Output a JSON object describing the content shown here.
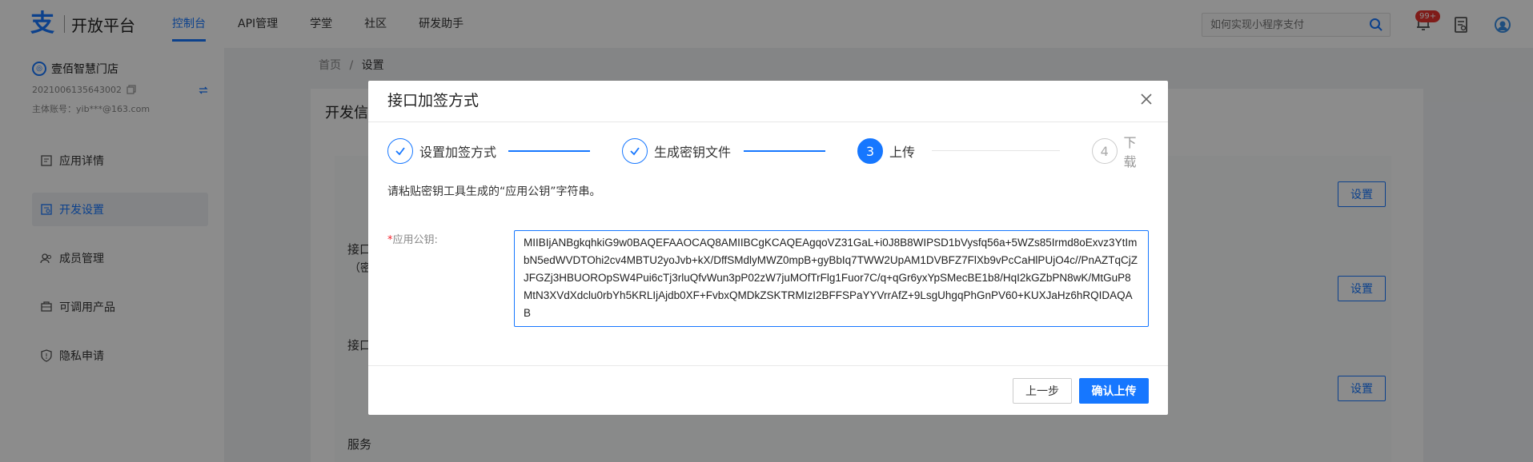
{
  "header": {
    "brand": "开放平台",
    "nav": [
      {
        "label": "控制台",
        "active": true
      },
      {
        "label": "API管理"
      },
      {
        "label": "学堂"
      },
      {
        "label": "社区"
      },
      {
        "label": "研发助手"
      }
    ],
    "search_placeholder": "如何实现小程序支付",
    "notification_badge": "99+"
  },
  "sidebar": {
    "shop_name": "壹佰智慧门店",
    "account_id": "2021006135643002",
    "main_account": "主体账号：yib***@163.com",
    "items": [
      {
        "label": "应用详情",
        "icon": "app-detail-icon"
      },
      {
        "label": "开发设置",
        "icon": "dev-settings-icon",
        "active": true
      },
      {
        "label": "成员管理",
        "icon": "members-icon"
      },
      {
        "label": "可调用产品",
        "icon": "products-icon"
      },
      {
        "label": "隐私申请",
        "icon": "privacy-shield-icon"
      }
    ]
  },
  "breadcrumb": {
    "home": "首页",
    "separator": "/",
    "current": "设置"
  },
  "main": {
    "card_title": "开发信",
    "rows": [
      {
        "label": "接口",
        "sublabel": "（密"
      },
      {
        "label": "接口"
      },
      {
        "label": "服务"
      }
    ],
    "set_label": "设置"
  },
  "modal": {
    "title": "接口加签方式",
    "steps": [
      {
        "label": "设置加签方式",
        "status": "done"
      },
      {
        "label": "生成密钥文件",
        "status": "done"
      },
      {
        "label": "上传",
        "number": "3",
        "status": "active"
      },
      {
        "label": "下载",
        "number": "4",
        "status": "wait"
      }
    ],
    "hint": "请粘贴密钥工具生成的“应用公钥”字符串。",
    "field_required": "*",
    "field_label": "应用公钥:",
    "public_key": "MIIBIjANBgkqhkiG9w0BAQEFAAOCAQ8AMIIBCgKCAQEAgqoVZ31GaL+i0J8B8WIPSD1bVysfq56a+5WZs85Irmd8oExvz3YtImbN5edWVDTOhi2cv4MBTU2yoJvb+kX/DffSMdlyMWZ0mpB+gyBbIq7TWW2UpAM1DVBFZ7FlXb9vPcCaHlPUjO4c//PnAZTqCjZJFGZj3HBUOROpSW4Pui6cTj3rluQfvWun3pP02zW7juMOfTrFlg1Fuor7C/q+qGr6yxYpSMecBE1b8/HqI2kGZbPN8wK/MtGuP8MtN3XVdXdclu0rbYh5KRLIjAjdb0XF+FvbxQMDkZSKTRMIzI2BFFSPaYYVrrAfZ+9LsgUhgqPhGnPV60+KUXJaHz6hRQIDAQAB",
    "prev_label": "上一步",
    "confirm_label": "确认上传"
  },
  "colors": {
    "primary": "#1677ff",
    "badge": "#e8342f"
  }
}
